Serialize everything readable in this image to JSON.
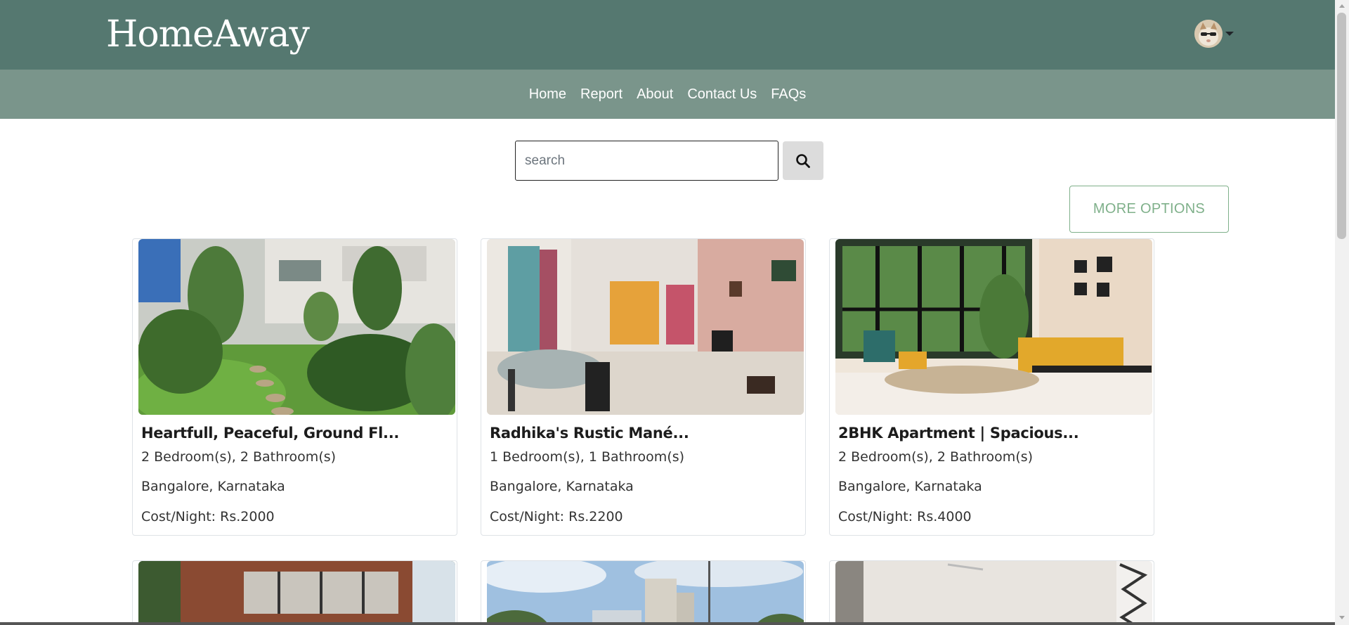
{
  "brand": "HomeAway",
  "nav": [
    "Home",
    "Report",
    "About",
    "Contact Us",
    "FAQs"
  ],
  "search": {
    "placeholder": "search",
    "value": ""
  },
  "more_options": "MORE OPTIONS",
  "listings": [
    {
      "title": "Heartfull, Peaceful, Ground Fl...",
      "rooms": "2 Bedroom(s), 2 Bathroom(s)",
      "location": "Bangalore, Karnataka",
      "cost": "Cost/Night: Rs.2000"
    },
    {
      "title": "Radhika's Rustic Mané...",
      "rooms": "1 Bedroom(s), 1 Bathroom(s)",
      "location": "Bangalore, Karnataka",
      "cost": "Cost/Night: Rs.2200"
    },
    {
      "title": "2BHK Apartment | Spacious...",
      "rooms": "2 Bedroom(s), 2 Bathroom(s)",
      "location": "Bangalore, Karnataka",
      "cost": "Cost/Night: Rs.4000"
    }
  ],
  "icons": {
    "search": "search-icon",
    "avatar": "user-avatar",
    "caret": "caret-down-icon"
  },
  "colors": {
    "header": "#557870",
    "nav": "#7a958b",
    "accent": "#7fb08a"
  }
}
